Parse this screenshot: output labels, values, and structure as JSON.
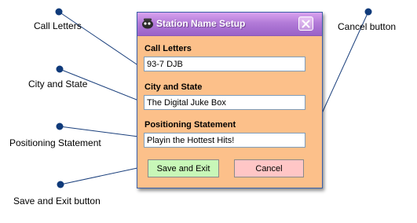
{
  "callouts": {
    "call_letters": "Call Letters",
    "city_state": "City and State",
    "positioning": "Positioning Statement",
    "save_exit": "Save and Exit button",
    "cancel": "Cancel button"
  },
  "dialog": {
    "title": "Station Name Setup",
    "close_icon": "close-icon",
    "fields": {
      "call_letters": {
        "label": "Call Letters",
        "value": "93-7 DJB"
      },
      "city_state": {
        "label": "City and State",
        "value": "The Digital Juke Box"
      },
      "positioning": {
        "label": "Positioning Statement",
        "value": "Playin the Hottest Hits!"
      }
    },
    "buttons": {
      "save_exit": "Save and Exit",
      "cancel": "Cancel"
    }
  },
  "colors": {
    "dialog_bg": "#fcc08a",
    "titlebar": "#b27bd8",
    "save_button": "#c8f7b8",
    "cancel_button": "#ffc6c6",
    "callout_line": "#0f3a7a"
  }
}
